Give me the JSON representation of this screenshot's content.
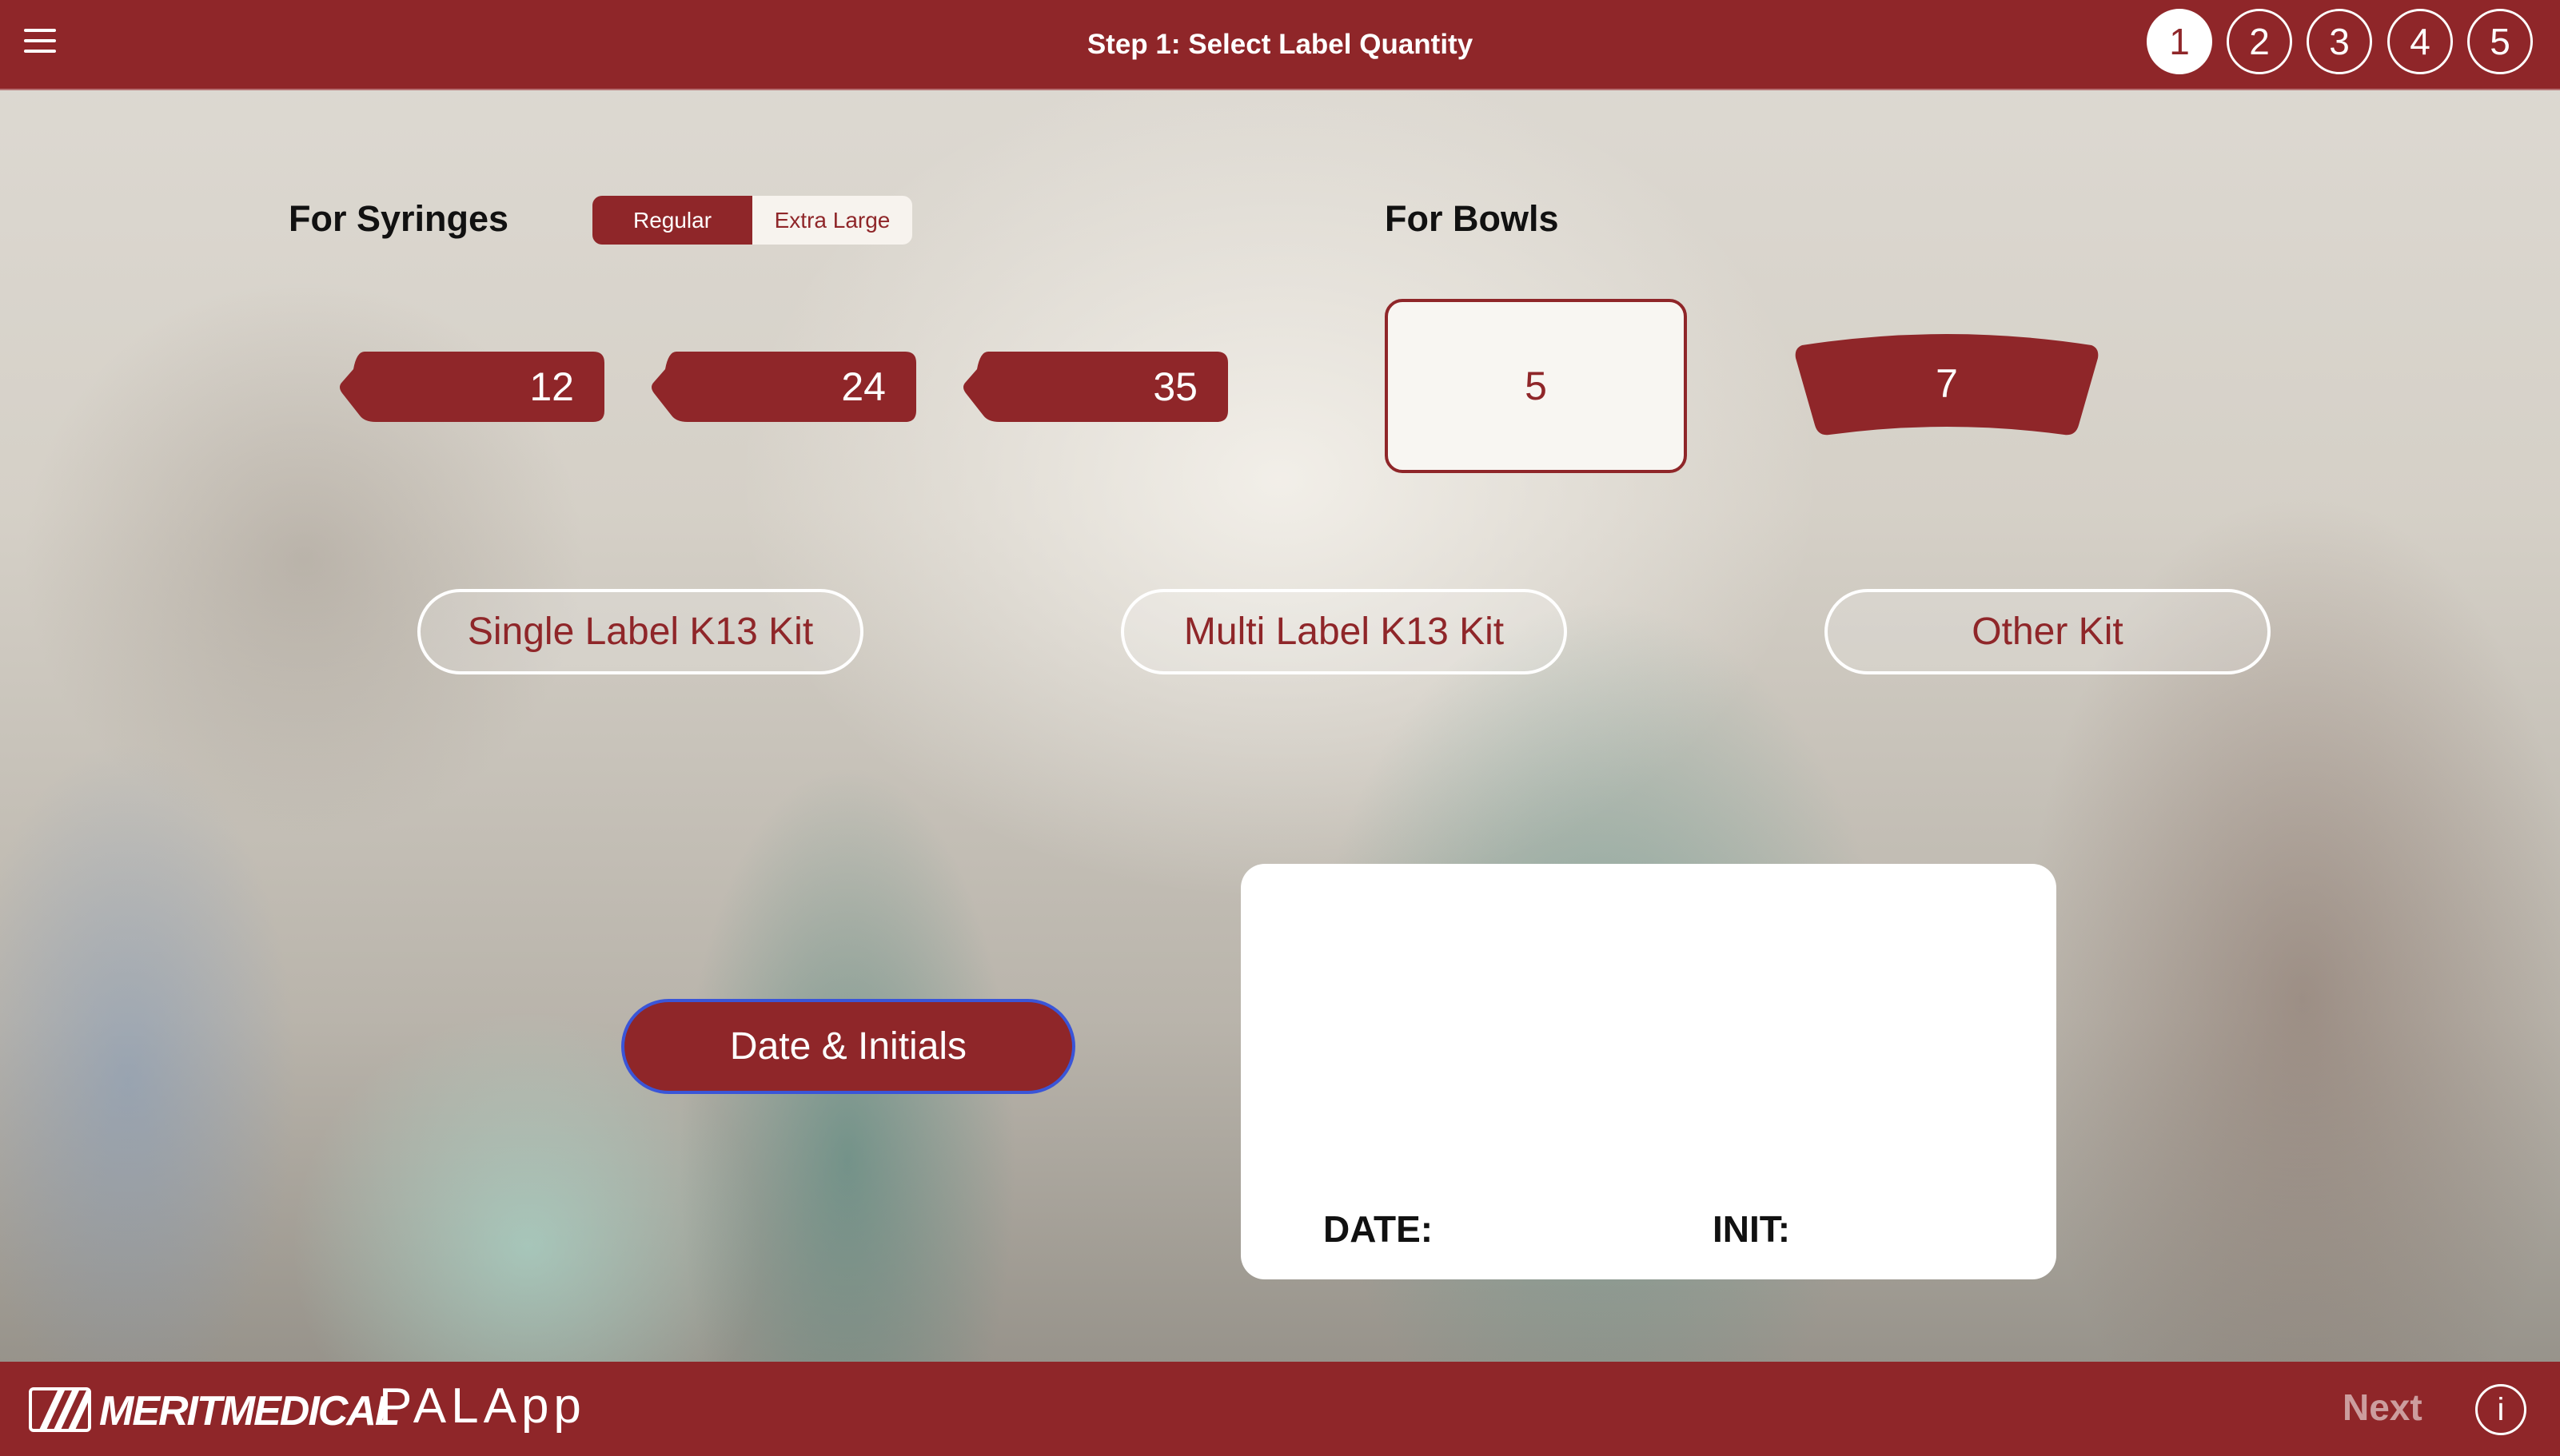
{
  "header": {
    "title": "Step 1: Select Label Quantity",
    "steps": [
      "1",
      "2",
      "3",
      "4",
      "5"
    ],
    "active_step": 1
  },
  "syringes": {
    "title": "For Syringes",
    "size_toggle": {
      "options": [
        "Regular",
        "Extra Large"
      ],
      "selected": "Regular"
    },
    "quantities": [
      "12",
      "24",
      "35"
    ]
  },
  "bowls": {
    "title": "For Bowls",
    "quantities": [
      "5",
      "7"
    ],
    "selected": "5"
  },
  "kits": {
    "single": "Single Label K13 Kit",
    "multi": "Multi Label K13 Kit",
    "other": "Other Kit"
  },
  "date_initials_button": "Date & Initials",
  "label_preview": {
    "date_label": "DATE:",
    "init_label": "INIT:"
  },
  "footer": {
    "brand": "MERITMEDICAL",
    "app_name": "PALApp",
    "next": "Next",
    "info": "i"
  },
  "colors": {
    "brand_red": "#8f2629",
    "focus_blue": "#3a55d8"
  }
}
